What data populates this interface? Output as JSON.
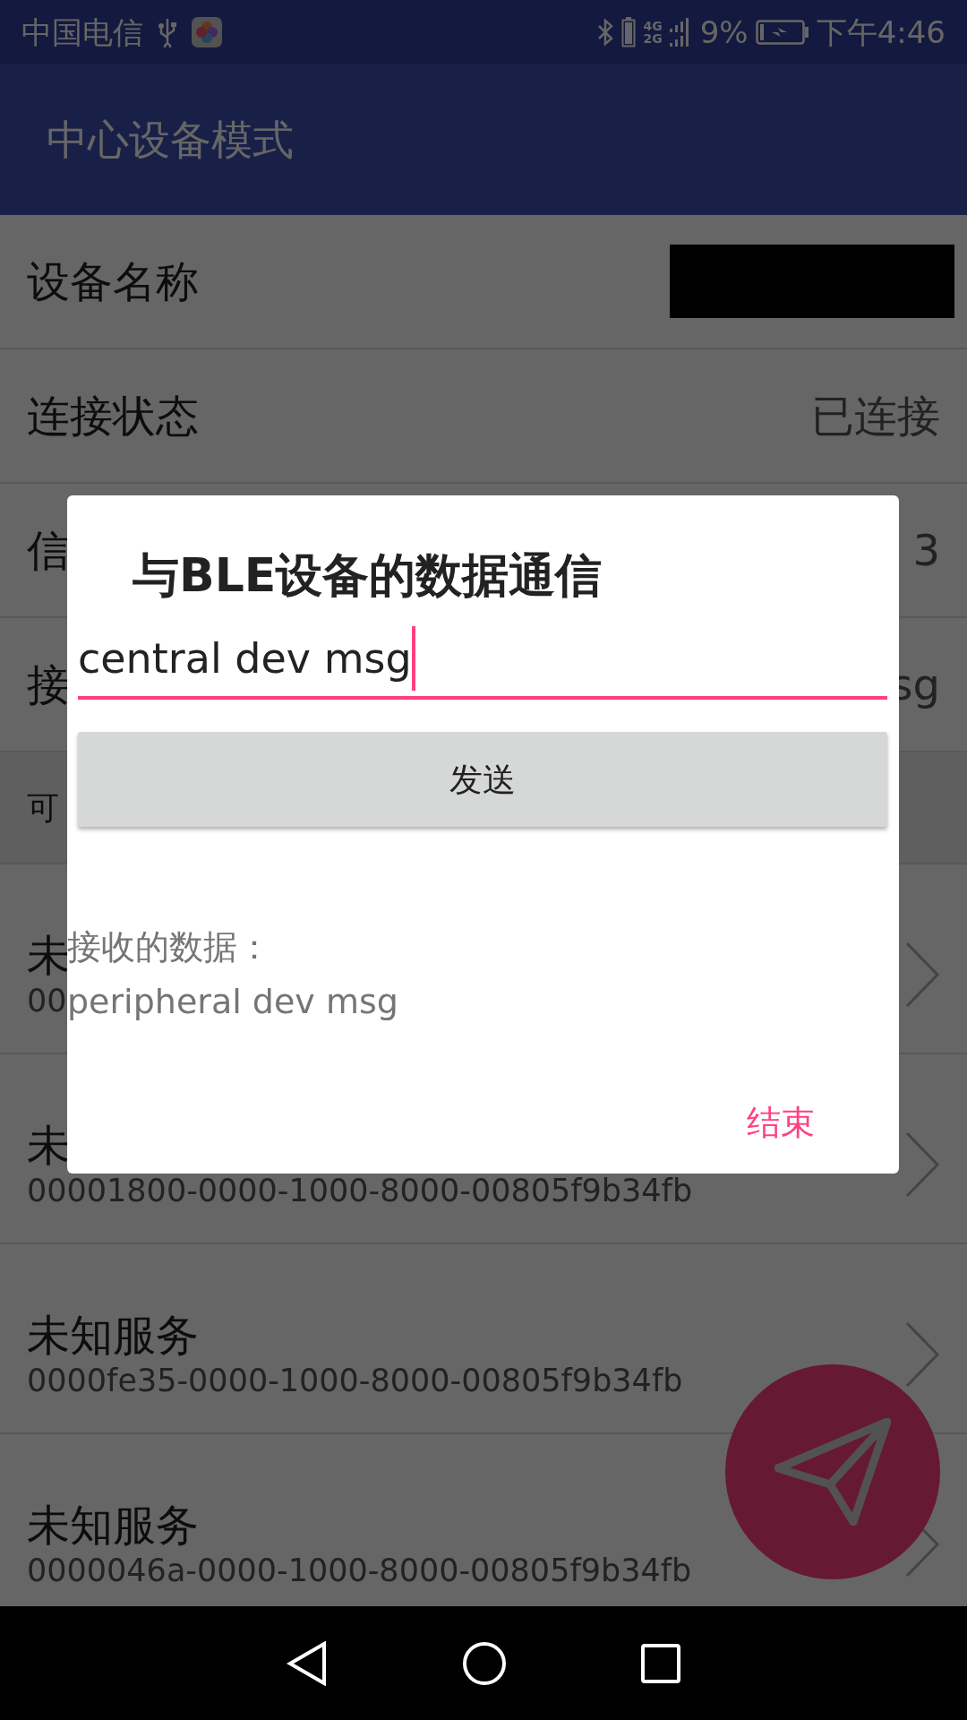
{
  "status_bar": {
    "carrier": "中国电信",
    "network_top": "4G",
    "network_bottom": "2G",
    "battery": "9%",
    "time": "下午4:46"
  },
  "toolbar": {
    "title": "中心设备模式"
  },
  "info_rows": [
    {
      "label": "设备名称",
      "value_redacted": true
    },
    {
      "label": "连接状态",
      "value": "已连接"
    },
    {
      "label": "信",
      "value": "3"
    },
    {
      "label": "接",
      "value": "sg"
    }
  ],
  "section_header": {
    "label": "可"
  },
  "services": [
    {
      "name": "未",
      "uuid": "00"
    },
    {
      "name": "未",
      "uuid": "00001800-0000-1000-8000-00805f9b34fb"
    },
    {
      "name": "未知服务",
      "uuid": "0000fe35-0000-1000-8000-00805f9b34fb"
    },
    {
      "name": "未知服务",
      "uuid": "0000046a-0000-1000-8000-00805f9b34fb"
    }
  ],
  "dialog": {
    "title": "与BLE设备的数据通信",
    "input_value": "central dev msg",
    "focused": true,
    "send_button": "发送",
    "received_label": "接收的数据：",
    "received_value": "peripheral dev msg",
    "end_button": "结束"
  }
}
